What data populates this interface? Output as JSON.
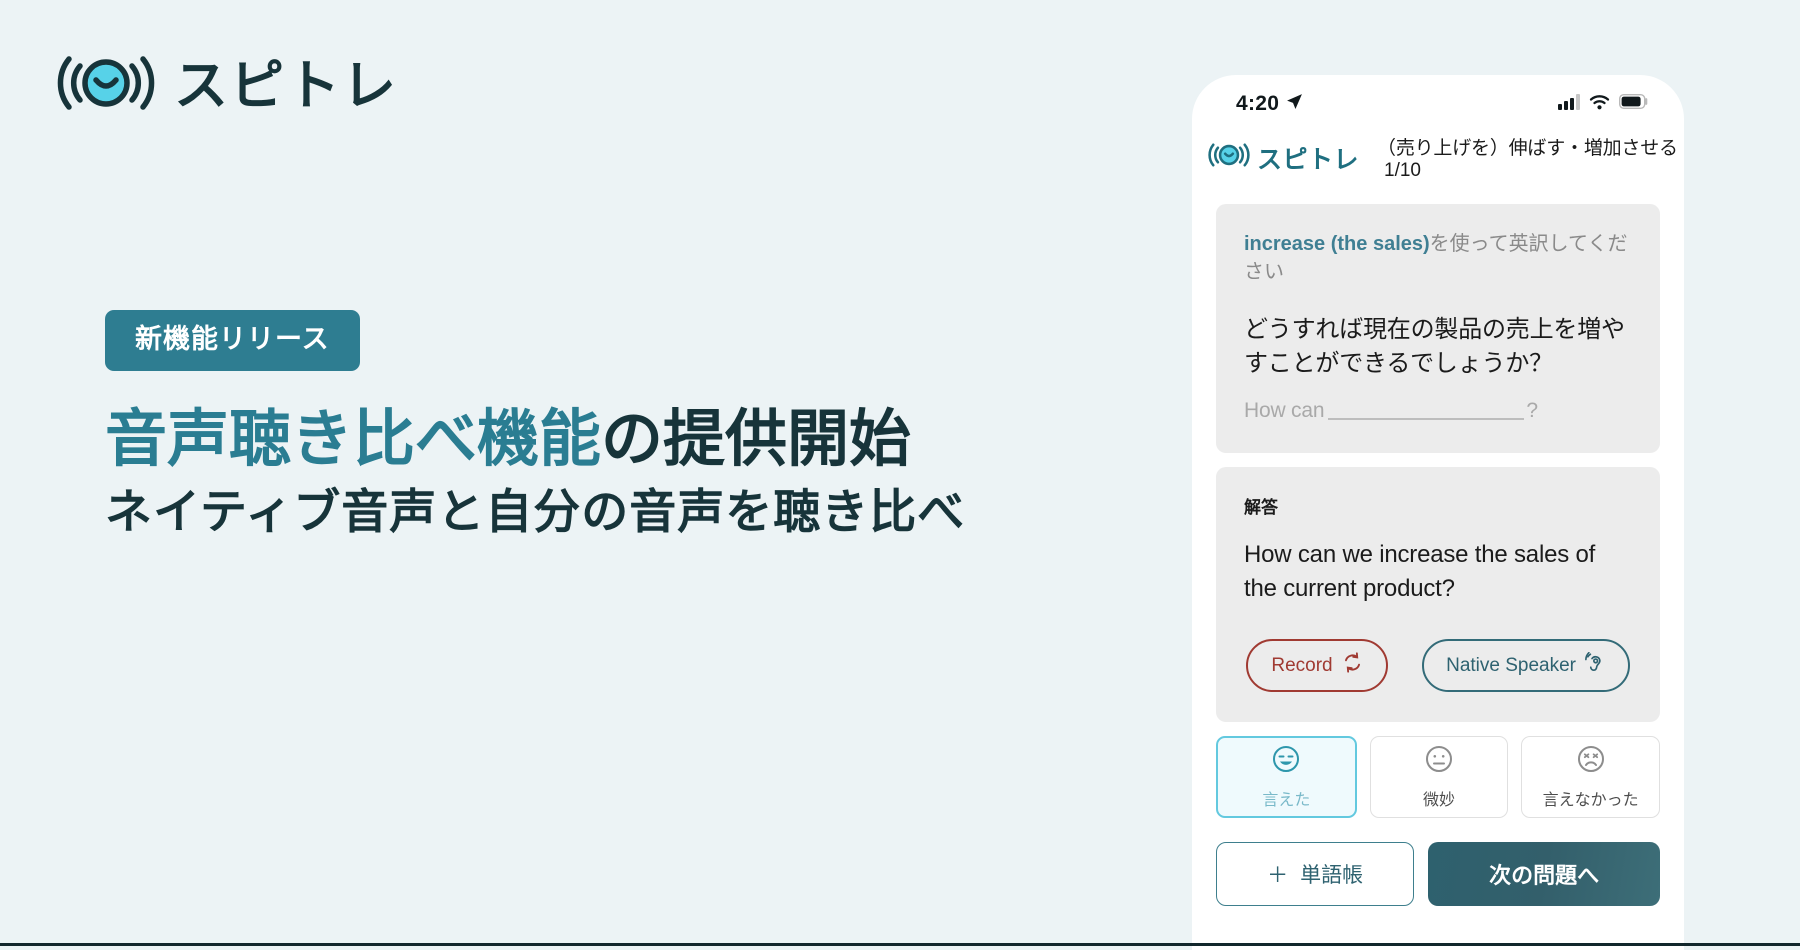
{
  "theme": {
    "page_bg": "#ecf3f5",
    "accent_teal": "#2a7d92",
    "dark_ink": "#17343a",
    "logo_cyan": "#57d2e8",
    "card_bg": "#ececec",
    "record_red": "#a03a32",
    "selected_cyan": "#63c9df"
  },
  "brand": {
    "logo_icon": "speaker-smiley-waves-icon",
    "name": "スピトレ"
  },
  "hero": {
    "badge": "新機能リリース",
    "headline_accent": "音声聴き比べ機能",
    "headline_dark": "の提供開始",
    "subheadline": "ネイティブ音声と自分の音声を聴き比べ"
  },
  "phone": {
    "status_bar": {
      "time": "4:20",
      "location_icon": "location-arrow-icon",
      "signal_icon": "cellular-signal-icon",
      "wifi_icon": "wifi-icon",
      "battery_icon": "battery-icon"
    },
    "app_header": {
      "logo_icon": "speaker-smiley-waves-icon",
      "logo_name": "スピトレ",
      "title": "（売り上げを）伸ばす・増加させる",
      "counter": "1/10"
    },
    "question_card": {
      "prompt_term": "increase (the sales)",
      "prompt_rest": "を使って英訳してください",
      "japanese_question": "どうすれば現在の製品の売上を増やすことができるでしょうか？",
      "hint_prefix": "How can",
      "hint_suffix": "?"
    },
    "answer_card": {
      "label": "解答",
      "text": "How can we increase the sales of the current product?",
      "record_button": "Record",
      "record_icon": "refresh-loop-icon",
      "native_button": "Native Speaker",
      "native_icon": "ear-listen-icon"
    },
    "ratings": [
      {
        "label": "言えた",
        "icon": "smiling-face-icon",
        "selected": true
      },
      {
        "label": "微妙",
        "icon": "neutral-face-icon",
        "selected": false
      },
      {
        "label": "言えなかった",
        "icon": "dizzy-sad-face-icon",
        "selected": false
      }
    ],
    "actions": {
      "vocab_plus": "＋",
      "vocab_label": "単語帳",
      "next_label": "次の問題へ"
    }
  }
}
